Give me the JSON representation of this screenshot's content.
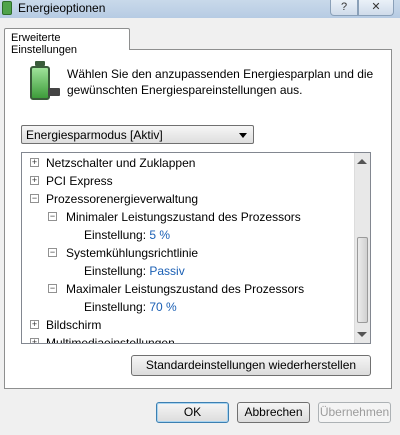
{
  "window": {
    "title": "Energieoptionen",
    "caption": {
      "help": "?",
      "close": "✕"
    }
  },
  "tab": {
    "label": "Erweiterte Einstellungen"
  },
  "intro": "Wählen Sie den anzupassenden Energiesparplan und die gewünschten Energiespareinstellungen aus.",
  "plan_select": {
    "value": "Energiesparmodus [Aktiv]"
  },
  "tree": {
    "rows": [
      {
        "level": 0,
        "expander": "+",
        "label": "Netzschalter und Zuklappen"
      },
      {
        "level": 0,
        "expander": "+",
        "label": "PCI Express"
      },
      {
        "level": 0,
        "expander": "−",
        "label": "Prozessorenergieverwaltung"
      },
      {
        "level": 1,
        "expander": "−",
        "label": "Minimaler Leistungszustand des Prozessors"
      },
      {
        "level": 2,
        "setting_label": "Einstellung:",
        "value": "5 %"
      },
      {
        "level": 1,
        "expander": "−",
        "label": "Systemkühlungsrichtlinie"
      },
      {
        "level": 2,
        "setting_label": "Einstellung:",
        "value": "Passiv"
      },
      {
        "level": 1,
        "expander": "−",
        "label": "Maximaler Leistungszustand des Prozessors"
      },
      {
        "level": 2,
        "setting_label": "Einstellung:",
        "value": "70 %"
      },
      {
        "level": 0,
        "expander": "+",
        "label": "Bildschirm"
      },
      {
        "level": 0,
        "expander": "+",
        "label": "Multimediaeinstellungen"
      }
    ]
  },
  "buttons": {
    "restore": "Standardeinstellungen wiederherstellen",
    "ok": "OK",
    "cancel": "Abbrechen",
    "apply": "Übernehmen"
  }
}
